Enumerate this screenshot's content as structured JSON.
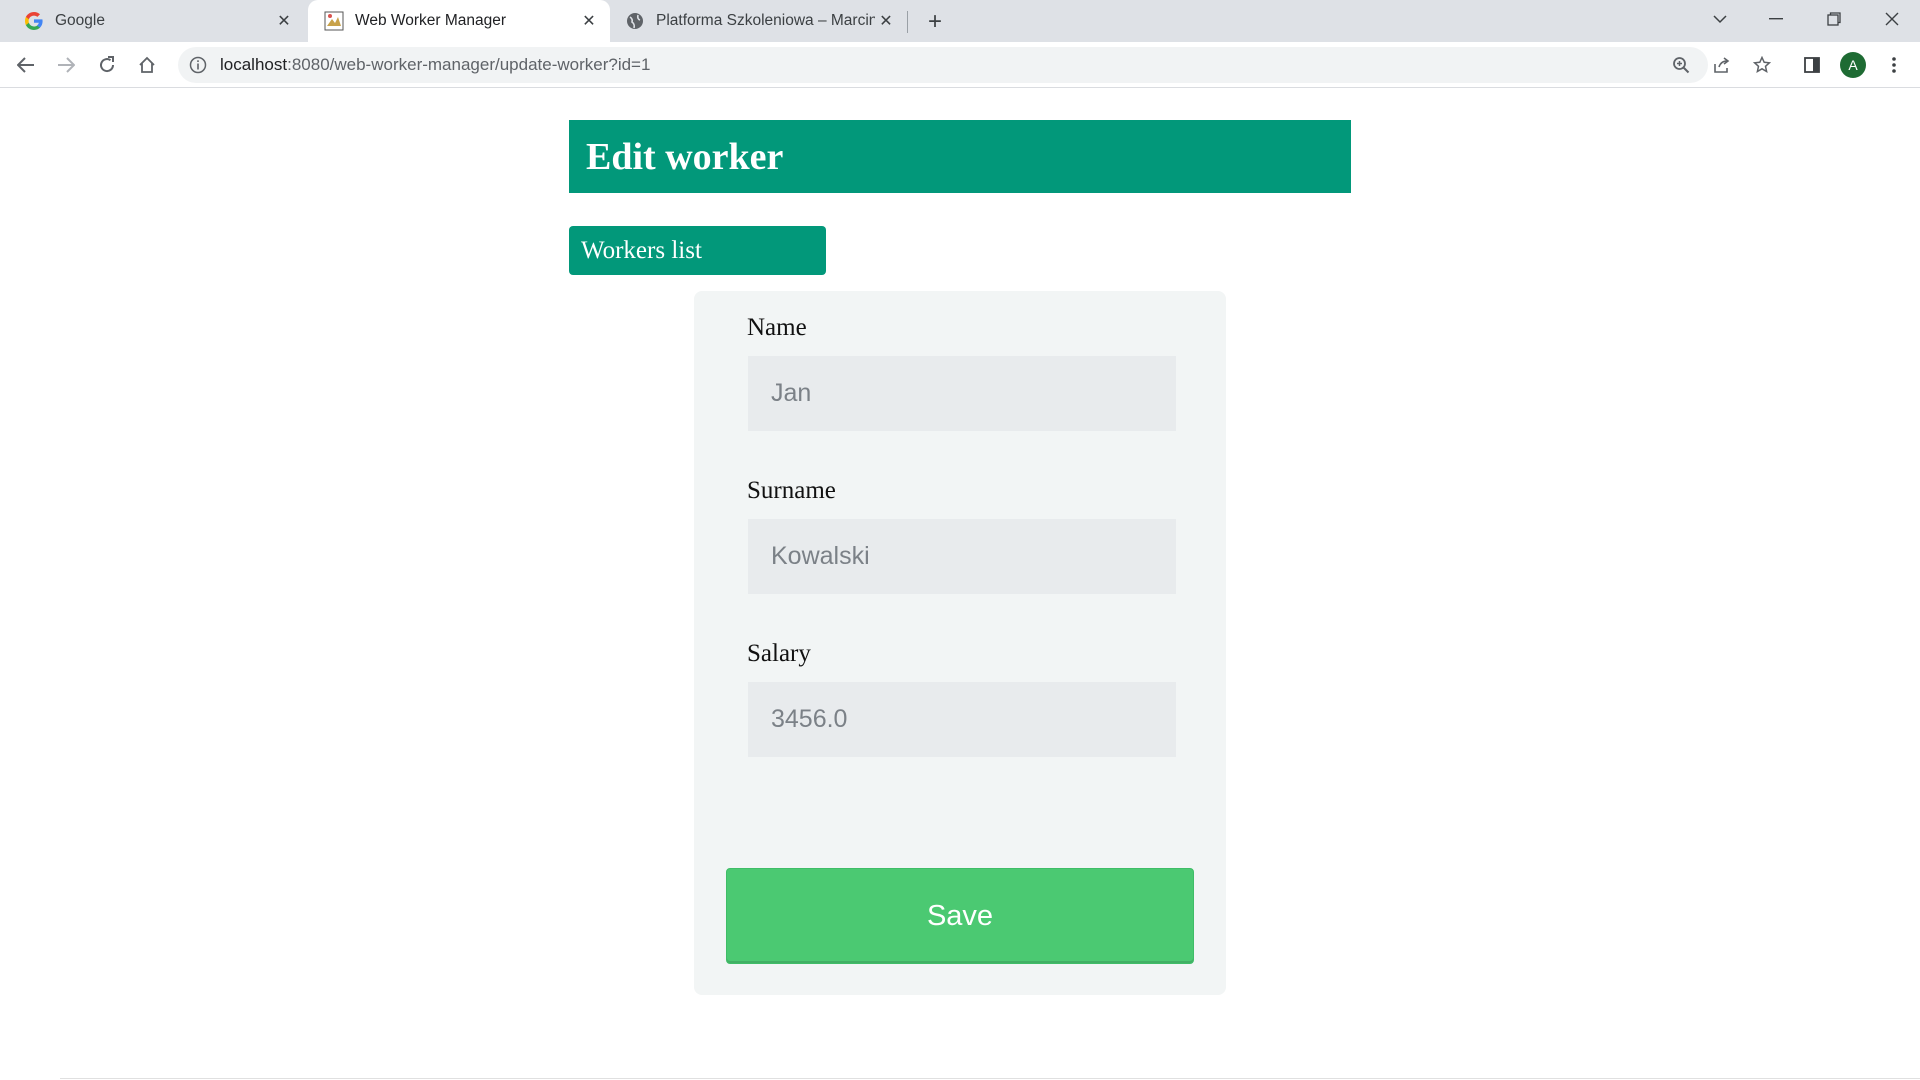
{
  "browser": {
    "tabs": [
      {
        "title": "Google",
        "icon": "google-icon",
        "active": false
      },
      {
        "title": "Web Worker Manager",
        "icon": "site-favicon",
        "active": true
      },
      {
        "title": "Platforma Szkoleniowa – Marcin",
        "icon": "globe-icon",
        "active": false
      }
    ],
    "address": {
      "host": "localhost",
      "rest": ":8080/web-worker-manager/update-worker?id=1"
    },
    "profile_initial": "A"
  },
  "page": {
    "title": "Edit worker",
    "workers_list_link": "Workers list",
    "form": {
      "fields": [
        {
          "label": "Name",
          "value": "Jan"
        },
        {
          "label": "Surname",
          "value": "Kowalski"
        },
        {
          "label": "Salary",
          "value": "3456.0"
        }
      ],
      "save_label": "Save"
    }
  },
  "colors": {
    "header": "#02987a",
    "save_button": "#4bc972",
    "card": "#f2f5f5",
    "input": "#e8ebed"
  }
}
